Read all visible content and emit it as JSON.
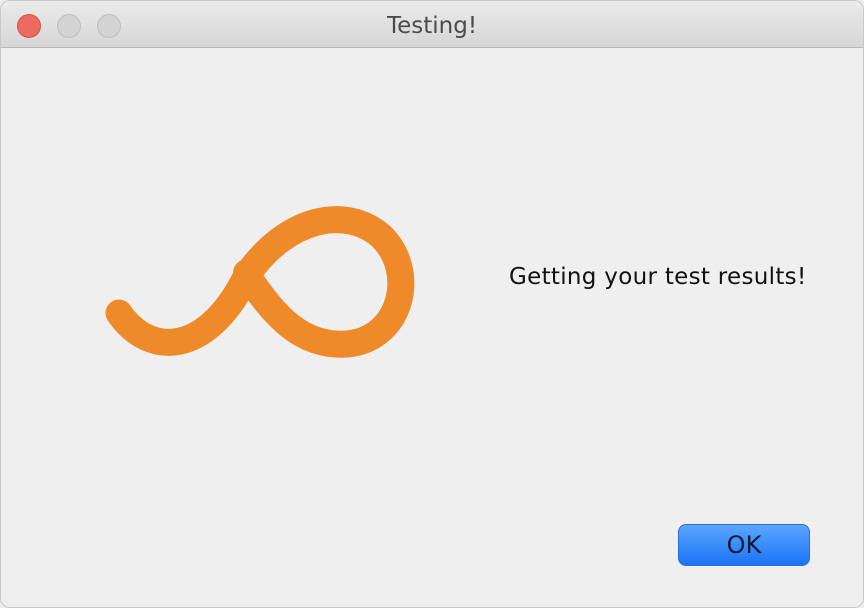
{
  "window": {
    "title": "Testing!"
  },
  "icons": {
    "close": "close-icon",
    "minimize": "minimize-icon",
    "maximize": "maximize-icon",
    "logo": "loop-logo"
  },
  "colors": {
    "logo": "#ee8a2a",
    "close": "#ed6a5e",
    "button": "#1b74f5"
  },
  "content": {
    "message": "Getting your test results!"
  },
  "buttons": {
    "ok_label": "OK"
  }
}
